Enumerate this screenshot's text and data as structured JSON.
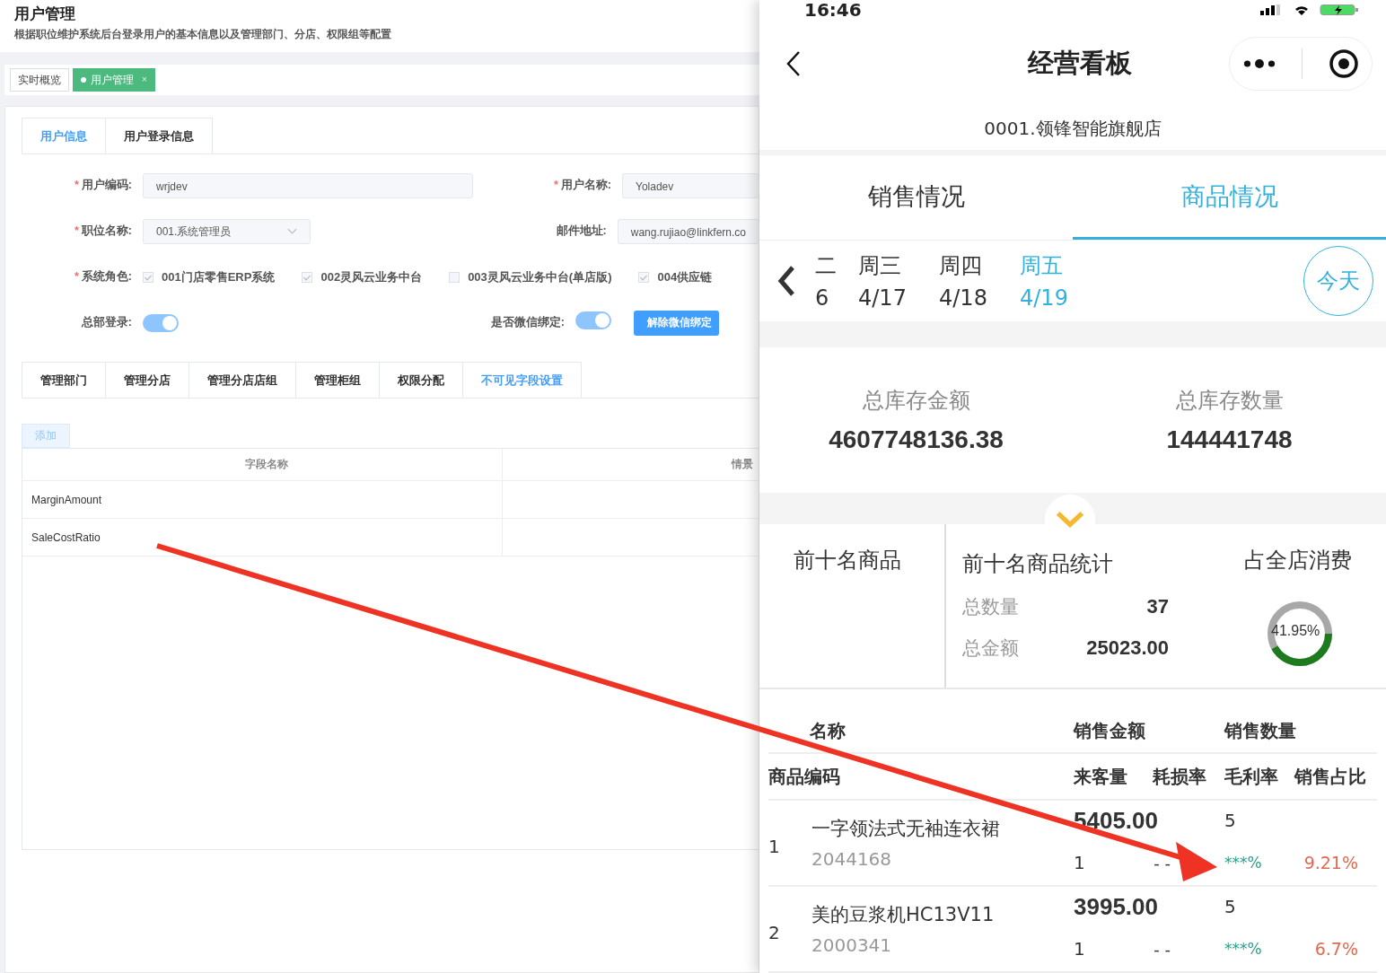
{
  "admin": {
    "title": "用户管理",
    "subtitle": "根据职位维护系统后台登录用户的基本信息以及管理部门、分店、权限组等配置",
    "page_tabs": [
      {
        "label": "实时概览",
        "selected": false
      },
      {
        "label": "用户管理",
        "selected": true,
        "close": "×"
      }
    ],
    "tabs": [
      {
        "label": "用户信息",
        "selected": true
      },
      {
        "label": "用户登录信息",
        "selected": false
      }
    ],
    "fields": {
      "user_code": {
        "label": "用户编码:",
        "required_mark": "*",
        "value": "wrjdev"
      },
      "user_name": {
        "label": "用户名称:",
        "required_mark": "*",
        "value": "Yoladev"
      },
      "position": {
        "label": "职位名称:",
        "required_mark": "*",
        "value": "001.系统管理员"
      },
      "email": {
        "label": "邮件地址:",
        "value": "wang.rujiao@linkfern.co"
      }
    },
    "roles": {
      "label": "系统角色:",
      "required_mark": "*",
      "options": [
        {
          "label": "001门店零售ERP系统",
          "checked": true
        },
        {
          "label": "002灵风云业务中台",
          "checked": true
        },
        {
          "label": "003灵风云业务中台(单店版)",
          "checked": false
        },
        {
          "label": "004供应链",
          "checked": true
        }
      ]
    },
    "hq_login": {
      "label": "总部登录:",
      "on": true
    },
    "wechat_bound": {
      "label": "是否微信绑定:",
      "on": true
    },
    "unbind_button": "解除微信绑定",
    "sub_tabs": [
      {
        "label": "管理部门",
        "selected": false
      },
      {
        "label": "管理分店",
        "selected": false
      },
      {
        "label": "管理分店店组",
        "selected": false
      },
      {
        "label": "管理柜组",
        "selected": false
      },
      {
        "label": "权限分配",
        "selected": false
      },
      {
        "label": "不可见字段设置",
        "selected": true
      }
    ],
    "add_button": "添加",
    "table": {
      "columns": [
        "字段名称",
        "情景"
      ],
      "rows": [
        [
          "MarginAmount"
        ],
        [
          "SaleCostRatio"
        ]
      ]
    }
  },
  "phone": {
    "time": "16:46",
    "title": "经营看板",
    "store": "0001.领锋智能旗舰店",
    "tabs": [
      {
        "label": "销售情况",
        "selected": false
      },
      {
        "label": "商品情况",
        "selected": true
      }
    ],
    "days": [
      {
        "weekday": "二",
        "date": "6",
        "selected": false
      },
      {
        "weekday": "周三",
        "date": "4/17",
        "selected": false
      },
      {
        "weekday": "周四",
        "date": "4/18",
        "selected": false
      },
      {
        "weekday": "周五",
        "date": "4/19",
        "selected": true
      }
    ],
    "today_button": "今天",
    "stats": [
      {
        "label": "总库存金额",
        "value": "4607748136.38"
      },
      {
        "label": "总库存数量",
        "value": "144441748"
      }
    ],
    "top10_title": "前十名商品",
    "top10_stats": {
      "title": "前十名商品统计",
      "rows": [
        {
          "label": "总数量",
          "value": "37"
        },
        {
          "label": "总金额",
          "value": "25023.00"
        }
      ]
    },
    "share": {
      "title": "占全店消费",
      "reading": "41.95%",
      "level": 0.4195
    },
    "table": {
      "header_1": [
        "名称",
        "销售金额",
        "销售数量"
      ],
      "header_2": [
        "商品编码",
        "来客量",
        "耗损率",
        "毛利率",
        "销售占比"
      ],
      "rows": [
        {
          "index": "1",
          "name": "一字领法式无袖连衣裙",
          "code": "2044168",
          "amount": "5405.00",
          "qty": "5",
          "visitors": "1",
          "loss": "- -",
          "margin": "***%",
          "share": "9.21%"
        },
        {
          "index": "2",
          "name": "美的豆浆机HC13V11",
          "code": "2000341",
          "amount": "3995.00",
          "qty": "5",
          "visitors": "1",
          "loss": "- -",
          "margin": "***%",
          "share": "6.7%"
        }
      ]
    }
  },
  "annotation": {
    "kind": "arrow"
  }
}
